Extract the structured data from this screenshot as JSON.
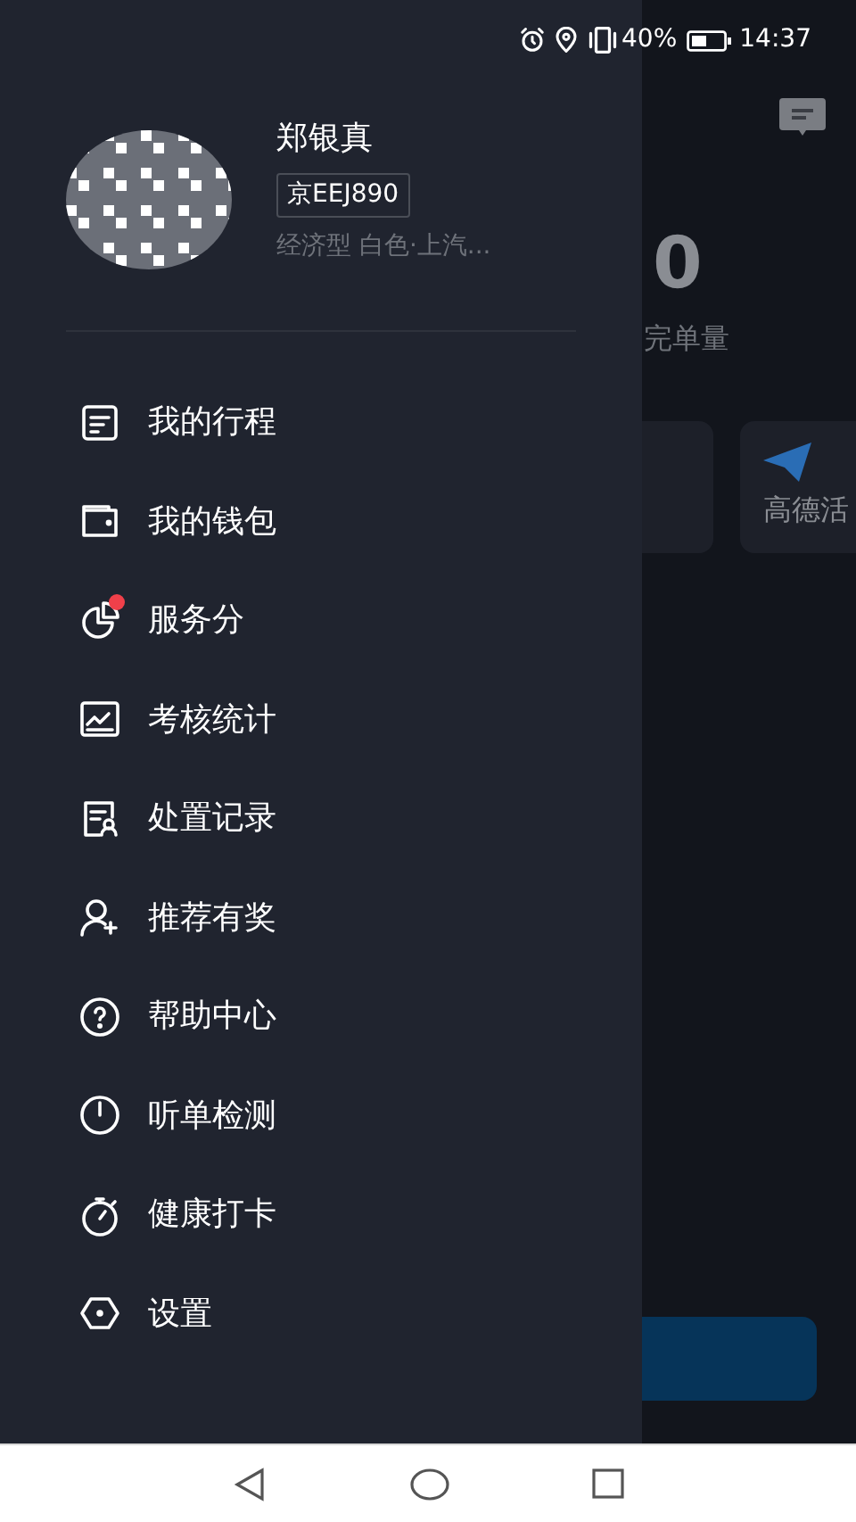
{
  "status_bar": {
    "battery": "40%",
    "time": "14:37"
  },
  "profile": {
    "name": "郑银真",
    "plate": "京EEJ890",
    "vehicle": "经济型 白色·上汽..."
  },
  "menu": [
    {
      "label": "我的行程",
      "badge": false
    },
    {
      "label": "我的钱包",
      "badge": false
    },
    {
      "label": "服务分",
      "badge": true
    },
    {
      "label": "考核统计",
      "badge": false
    },
    {
      "label": "处置记录",
      "badge": false
    },
    {
      "label": "推荐有奖",
      "badge": false
    },
    {
      "label": "帮助中心",
      "badge": false
    },
    {
      "label": "听单检测",
      "badge": false
    },
    {
      "label": "健康打卡",
      "badge": false
    },
    {
      "label": "设置",
      "badge": false
    }
  ],
  "background": {
    "stat_value": "0",
    "stat_label": "完单量",
    "card_label": "高德活"
  }
}
